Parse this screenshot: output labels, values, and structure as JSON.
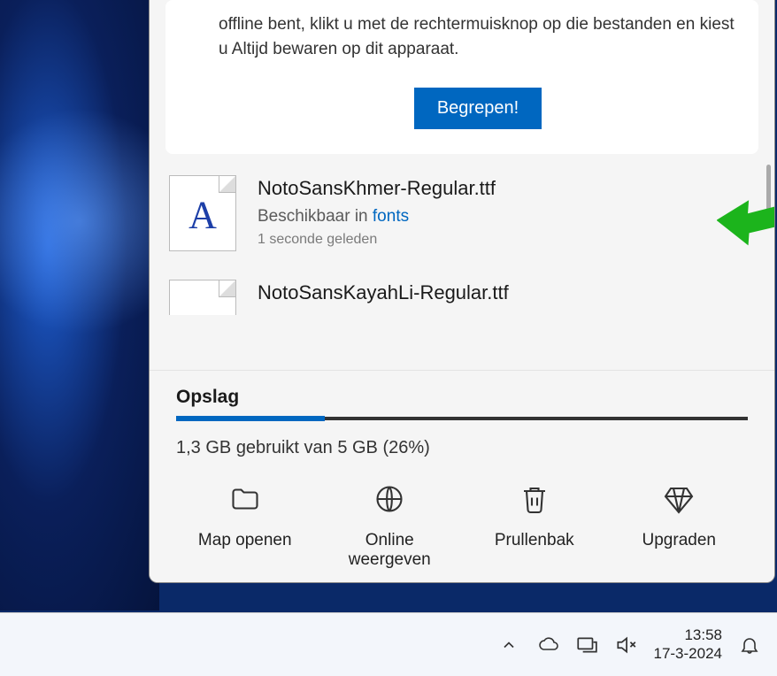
{
  "info": {
    "text": "offline bent, klikt u met de rechtermuisknop op die bestanden en kiest u Altijd bewaren op dit apparaat.",
    "button": "Begrepen!"
  },
  "files": [
    {
      "name": "NotoSansKhmer-Regular.ttf",
      "location_prefix": "Beschikbaar in ",
      "location_link": "fonts",
      "time": "1 seconde geleden"
    },
    {
      "name": "NotoSansKayahLi-Regular.ttf"
    }
  ],
  "storage": {
    "title": "Opslag",
    "text": "1,3 GB gebruikt van 5 GB (26%)",
    "percent": 26
  },
  "actions": {
    "open_folder": "Map openen",
    "view_online": "Online weergeven",
    "recycle_bin": "Prullenbak",
    "upgrade": "Upgraden"
  },
  "taskbar": {
    "time": "13:58",
    "date": "17-3-2024"
  }
}
